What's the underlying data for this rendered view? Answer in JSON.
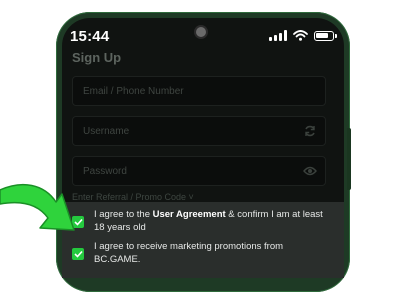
{
  "status": {
    "time": "15:44"
  },
  "form": {
    "title": "Sign Up",
    "email_placeholder": "Email / Phone Number",
    "username_placeholder": "Username",
    "password_placeholder": "Password",
    "referral_label": "Enter Referral / Promo Code ˅"
  },
  "agreements": {
    "terms": {
      "prefix": "I agree to the ",
      "link": "User Agreement",
      "suffix": " & confirm I am at least 18 years old",
      "checked": true
    },
    "marketing": {
      "text": "I agree to receive marketing promotions from BC.GAME.",
      "checked": true
    }
  },
  "colors": {
    "accent": "#24c93e",
    "screen_bg": "#101311",
    "panel_bg": "#2a2e2c",
    "arrow": "#2fd33c"
  }
}
